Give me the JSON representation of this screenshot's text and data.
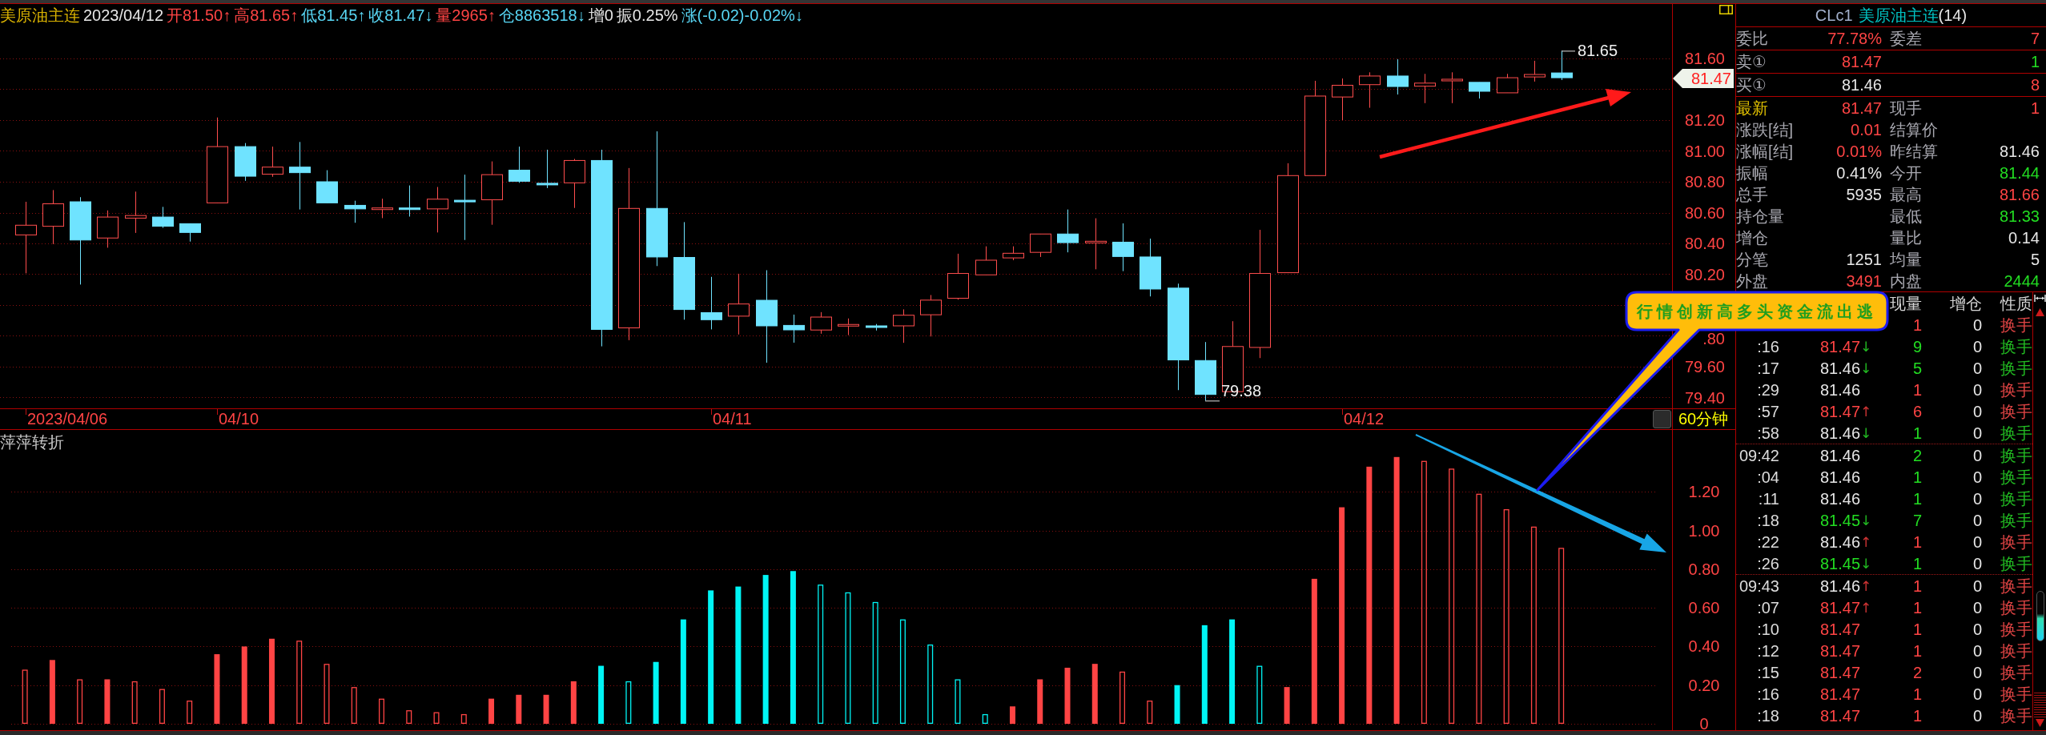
{
  "header": {
    "symbol": "美原油主连",
    "date": "2023/04/12",
    "fields": [
      {
        "text": "开81.50↑",
        "color": "#ff4444"
      },
      {
        "text": "高81.65↑",
        "color": "#ff4444"
      },
      {
        "text": "低81.45↑",
        "color": "#58d6f4"
      },
      {
        "text": "收81.47↓",
        "color": "#58d6f4"
      },
      {
        "text": "量2965↑",
        "color": "#ff4444"
      },
      {
        "text": "仓8863518↓",
        "color": "#58d6f4"
      },
      {
        "text": "增0",
        "color": "#e6e6e6"
      },
      {
        "text": "振0.25%",
        "color": "#e6e6e6"
      },
      {
        "text": "涨(-0.02)-0.02%↓",
        "color": "#58d6f4"
      }
    ]
  },
  "chart": {
    "price_labels": [
      "81.60",
      "81.20",
      "81.00",
      "80.80",
      "80.60",
      "80.40",
      "80.20",
      ".80",
      "79.60",
      "79.40"
    ],
    "last_price": "81.47",
    "high_mark": "81.65",
    "low_mark": "79.38",
    "dates": [
      "2023/04/06",
      "04/10",
      "04/11",
      "04/12"
    ],
    "period": "60分钟"
  },
  "indicator": {
    "chart_data": {
      "type": "bar",
      "title": "萍萍转折",
      "ylim": [
        0,
        1.52
      ],
      "grid": true,
      "yticks": [
        {
          "value": 0,
          "label": "0"
        },
        {
          "value": 0.2,
          "label": "0.20"
        },
        {
          "value": 0.4,
          "label": "0.40"
        },
        {
          "value": 0.6,
          "label": "0.60"
        },
        {
          "value": 0.8,
          "label": "0.80"
        },
        {
          "value": 1,
          "label": "1.00"
        },
        {
          "value": 1.2,
          "label": "1.20"
        }
      ],
      "series": [
        {
          "color": "#ff4444",
          "values": [
            0.28,
            0.33,
            0.23,
            0.23,
            0.22,
            0.18,
            0.12,
            0.36,
            0.4,
            0.44,
            0.43,
            0.31,
            0.19,
            0.13,
            0.07,
            0.06,
            0.05,
            0.13,
            0.15,
            0.15,
            0.22,
            null,
            null,
            null,
            null,
            null,
            null,
            null,
            null,
            null,
            null,
            null,
            null,
            null,
            null,
            null,
            0.09,
            0.23,
            0.29,
            0.31,
            0.27,
            0.12,
            null,
            null,
            null,
            null,
            0.19,
            0.75,
            1.12,
            1.33,
            1.38,
            1.36,
            1.32,
            1.19,
            1.11,
            1.02,
            0.91,
            null,
            null,
            null
          ]
        },
        {
          "color": "#00f5f5",
          "values": [
            null,
            null,
            null,
            null,
            null,
            null,
            null,
            null,
            null,
            null,
            null,
            null,
            null,
            null,
            null,
            null,
            null,
            null,
            null,
            null,
            null,
            0.3,
            0.22,
            0.32,
            0.54,
            0.69,
            0.71,
            0.77,
            0.79,
            0.72,
            0.68,
            0.63,
            0.54,
            0.41,
            0.23,
            0.05,
            null,
            null,
            null,
            null,
            null,
            null,
            0.2,
            0.51,
            0.54,
            0.3,
            null,
            null,
            null,
            null,
            null,
            null,
            null,
            null,
            null,
            null,
            null,
            null,
            null,
            null
          ]
        }
      ]
    }
  },
  "callout": {
    "text": "行情创新高多头资金流出逃"
  },
  "quote": {
    "code": "CLc1",
    "name": "美原油主连",
    "count": "(14)",
    "sections": [
      {
        "rows": [
          {
            "cells": [
              {
                "label": {
                  "text": "委比",
                  "color": "#a8a8b0"
                },
                "value": {
                  "text": "77.78%",
                  "color": "#ff4444"
                }
              },
              {
                "label": {
                  "text": "委差",
                  "color": "#a8a8b0"
                },
                "value": {
                  "text": "7",
                  "color": "#ff4444"
                }
              }
            ]
          }
        ]
      },
      {
        "rows": [
          {
            "cells": [
              {
                "label": {
                  "text": "卖①",
                  "color": "#a8a8b0"
                },
                "value": {
                  "text": "81.47",
                  "color": "#ff4444"
                }
              },
              {
                "value": {
                  "text": "1",
                  "color": "#22dd22"
                }
              }
            ]
          }
        ]
      },
      {
        "rows": [
          {
            "cells": [
              {
                "label": {
                  "text": "买①",
                  "color": "#a8a8b0"
                },
                "value": {
                  "text": "81.46",
                  "color": "#e6e6e6"
                }
              },
              {
                "value": {
                  "text": "8",
                  "color": "#ff4444"
                }
              }
            ]
          }
        ]
      },
      {
        "rows": [
          {
            "cells": [
              {
                "label": {
                  "text": "最新",
                  "color": "#e0c000"
                },
                "value": {
                  "text": "81.47",
                  "color": "#ff4444"
                }
              },
              {
                "label": {
                  "text": "现手",
                  "color": "#a8a8b0"
                },
                "value": {
                  "text": "1",
                  "color": "#ff4444"
                }
              }
            ]
          },
          {
            "cells": [
              {
                "label": {
                  "text": "涨跌[结]",
                  "color": "#a8a8b0"
                },
                "value": {
                  "text": "0.01",
                  "color": "#ff4444"
                }
              },
              {
                "label": {
                  "text": "结算价",
                  "color": "#a8a8b0"
                }
              }
            ]
          },
          {
            "cells": [
              {
                "label": {
                  "text": "涨幅[结]",
                  "color": "#a8a8b0"
                },
                "value": {
                  "text": "0.01%",
                  "color": "#ff4444"
                }
              },
              {
                "label": {
                  "text": "昨结算",
                  "color": "#a8a8b0"
                },
                "value": {
                  "text": "81.46",
                  "color": "#e6e6e6"
                }
              }
            ]
          },
          {
            "cells": [
              {
                "label": {
                  "text": "振幅",
                  "color": "#a8a8b0"
                },
                "value": {
                  "text": "0.41%",
                  "color": "#e6e6e6"
                }
              },
              {
                "label": {
                  "text": "今开",
                  "color": "#a8a8b0"
                },
                "value": {
                  "text": "81.44",
                  "color": "#22dd22"
                }
              }
            ]
          },
          {
            "cells": [
              {
                "label": {
                  "text": "总手",
                  "color": "#a8a8b0"
                },
                "value": {
                  "text": "5935",
                  "color": "#e6e6e6"
                }
              },
              {
                "label": {
                  "text": "最高",
                  "color": "#a8a8b0"
                },
                "value": {
                  "text": "81.66",
                  "color": "#ff4444"
                }
              }
            ]
          },
          {
            "cells": [
              {
                "label": {
                  "text": "持仓量",
                  "color": "#a8a8b0"
                }
              },
              {
                "label": {
                  "text": "最低",
                  "color": "#a8a8b0"
                },
                "value": {
                  "text": "81.33",
                  "color": "#22dd22"
                }
              }
            ]
          },
          {
            "cells": [
              {
                "label": {
                  "text": "增仓",
                  "color": "#a8a8b0"
                }
              },
              {
                "label": {
                  "text": "量比",
                  "color": "#a8a8b0"
                },
                "value": {
                  "text": "0.14",
                  "color": "#e6e6e6"
                }
              }
            ]
          },
          {
            "cells": [
              {
                "label": {
                  "text": "分笔",
                  "color": "#a8a8b0"
                },
                "value": {
                  "text": "1251",
                  "color": "#e6e6e6"
                }
              },
              {
                "label": {
                  "text": "均量",
                  "color": "#a8a8b0"
                },
                "value": {
                  "text": "5",
                  "color": "#e6e6e6"
                }
              }
            ]
          },
          {
            "cells": [
              {
                "label": {
                  "text": "外盘",
                  "color": "#a8a8b0"
                },
                "value": {
                  "text": "3491",
                  "color": "#ff4444"
                }
              },
              {
                "label": {
                  "text": "内盘",
                  "color": "#a8a8b0"
                },
                "value": {
                  "text": "2444",
                  "color": "#22dd22"
                }
              }
            ]
          }
        ]
      }
    ]
  },
  "trades": {
    "columns": [
      "现量",
      "增仓",
      "性质"
    ],
    "groups": [
      {
        "rows": [
          {
            "volume": {
              "text": "1",
              "color": "#ff4444"
            },
            "oi": "0",
            "nature": {
              "text": "换手",
              "color": "#e04444"
            }
          },
          {
            "time": ":16",
            "price": {
              "text": "81.47",
              "color": "#ff4444"
            },
            "arrow": {
              "text": "↓",
              "color": "#22bb22"
            },
            "volume": {
              "text": "9",
              "color": "#22dd22"
            },
            "oi": "0",
            "nature": {
              "text": "换手",
              "color": "#22bb22"
            }
          },
          {
            "time": ":17",
            "price": {
              "text": "81.46",
              "color": "#e6e6e6"
            },
            "arrow": {
              "text": "↓",
              "color": "#22bb22"
            },
            "volume": {
              "text": "5",
              "color": "#22dd22"
            },
            "oi": "0",
            "nature": {
              "text": "换手",
              "color": "#22bb22"
            }
          },
          {
            "time": ":29",
            "price": {
              "text": "81.46",
              "color": "#e6e6e6"
            },
            "volume": {
              "text": "1",
              "color": "#ff4444"
            },
            "oi": "0",
            "nature": {
              "text": "换手",
              "color": "#e04444"
            }
          },
          {
            "time": ":57",
            "price": {
              "text": "81.47",
              "color": "#ff4444"
            },
            "arrow": {
              "text": "↑",
              "color": "#cc3333"
            },
            "volume": {
              "text": "6",
              "color": "#ff4444"
            },
            "oi": "0",
            "nature": {
              "text": "换手",
              "color": "#e04444"
            }
          },
          {
            "time": ":58",
            "price": {
              "text": "81.46",
              "color": "#e6e6e6"
            },
            "arrow": {
              "text": "↓",
              "color": "#22bb22"
            },
            "volume": {
              "text": "1",
              "color": "#22dd22"
            },
            "oi": "0",
            "nature": {
              "text": "换手",
              "color": "#22bb22"
            }
          }
        ]
      },
      {
        "rows": [
          {
            "time": "09:42",
            "price": {
              "text": "81.46",
              "color": "#e6e6e6"
            },
            "volume": {
              "text": "2",
              "color": "#22dd22"
            },
            "oi": "0",
            "nature": {
              "text": "换手",
              "color": "#22bb22"
            }
          },
          {
            "time": ":04",
            "price": {
              "text": "81.46",
              "color": "#e6e6e6"
            },
            "volume": {
              "text": "1",
              "color": "#22dd22"
            },
            "oi": "0",
            "nature": {
              "text": "换手",
              "color": "#22bb22"
            }
          },
          {
            "time": ":11",
            "price": {
              "text": "81.46",
              "color": "#e6e6e6"
            },
            "volume": {
              "text": "1",
              "color": "#22dd22"
            },
            "oi": "0",
            "nature": {
              "text": "换手",
              "color": "#22bb22"
            }
          },
          {
            "time": ":18",
            "price": {
              "text": "81.45",
              "color": "#22dd22"
            },
            "arrow": {
              "text": "↓",
              "color": "#22bb22"
            },
            "volume": {
              "text": "7",
              "color": "#22dd22"
            },
            "oi": "0",
            "nature": {
              "text": "换手",
              "color": "#22bb22"
            }
          },
          {
            "time": ":22",
            "price": {
              "text": "81.46",
              "color": "#e6e6e6"
            },
            "arrow": {
              "text": "↑",
              "color": "#cc3333"
            },
            "volume": {
              "text": "1",
              "color": "#ff4444"
            },
            "oi": "0",
            "nature": {
              "text": "换手",
              "color": "#e04444"
            }
          },
          {
            "time": ":26",
            "price": {
              "text": "81.45",
              "color": "#22dd22"
            },
            "arrow": {
              "text": "↓",
              "color": "#22bb22"
            },
            "volume": {
              "text": "1",
              "color": "#22dd22"
            },
            "oi": "0",
            "nature": {
              "text": "换手",
              "color": "#22bb22"
            }
          }
        ]
      },
      {
        "rows": [
          {
            "time": "09:43",
            "price": {
              "text": "81.46",
              "color": "#e6e6e6"
            },
            "arrow": {
              "text": "↑",
              "color": "#cc3333"
            },
            "volume": {
              "text": "1",
              "color": "#ff4444"
            },
            "oi": "0",
            "nature": {
              "text": "换手",
              "color": "#e04444"
            }
          },
          {
            "time": ":07",
            "price": {
              "text": "81.47",
              "color": "#ff4444"
            },
            "arrow": {
              "text": "↑",
              "color": "#cc3333"
            },
            "volume": {
              "text": "1",
              "color": "#ff4444"
            },
            "oi": "0",
            "nature": {
              "text": "换手",
              "color": "#e04444"
            }
          },
          {
            "time": ":10",
            "price": {
              "text": "81.47",
              "color": "#ff4444"
            },
            "volume": {
              "text": "1",
              "color": "#ff4444"
            },
            "oi": "0",
            "nature": {
              "text": "换手",
              "color": "#e04444"
            }
          },
          {
            "time": ":12",
            "price": {
              "text": "81.47",
              "color": "#ff4444"
            },
            "volume": {
              "text": "1",
              "color": "#ff4444"
            },
            "oi": "0",
            "nature": {
              "text": "换手",
              "color": "#e04444"
            }
          },
          {
            "time": ":15",
            "price": {
              "text": "81.47",
              "color": "#ff4444"
            },
            "volume": {
              "text": "2",
              "color": "#ff4444"
            },
            "oi": "0",
            "nature": {
              "text": "换手",
              "color": "#e04444"
            }
          },
          {
            "time": ":16",
            "price": {
              "text": "81.47",
              "color": "#ff4444"
            },
            "volume": {
              "text": "1",
              "color": "#ff4444"
            },
            "oi": "0",
            "nature": {
              "text": "换手",
              "color": "#e04444"
            }
          },
          {
            "time": ":18",
            "price": {
              "text": "81.47",
              "color": "#ff4444"
            },
            "volume": {
              "text": "1",
              "color": "#ff4444"
            },
            "oi": "0",
            "nature": {
              "text": "换手",
              "color": "#e04444"
            }
          }
        ]
      }
    ]
  }
}
